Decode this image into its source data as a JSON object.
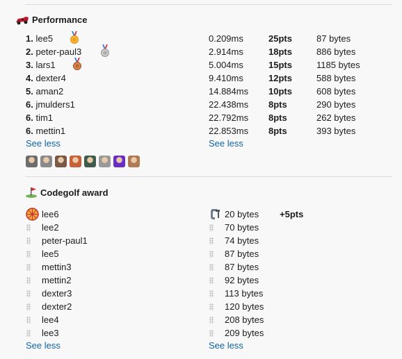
{
  "performance": {
    "title": "Performance",
    "rows": [
      {
        "rank": "1.",
        "name": "lee5",
        "time": "0.209ms",
        "pts": "25pts",
        "bytes": "87 bytes",
        "medal": "gold"
      },
      {
        "rank": "2.",
        "name": "peter-paul3",
        "time": "2.914ms",
        "pts": "18pts",
        "bytes": "886 bytes",
        "medal": "silver"
      },
      {
        "rank": "3.",
        "name": "lars1",
        "time": "5.004ms",
        "pts": "15pts",
        "bytes": "1185 bytes",
        "medal": "bronze"
      },
      {
        "rank": "4.",
        "name": "dexter4",
        "time": "9.410ms",
        "pts": "12pts",
        "bytes": "588 bytes",
        "medal": ""
      },
      {
        "rank": "5.",
        "name": "aman2",
        "time": "14.884ms",
        "pts": "10pts",
        "bytes": "608 bytes",
        "medal": ""
      },
      {
        "rank": "6.",
        "name": "jmulders1",
        "time": "22.438ms",
        "pts": "8pts",
        "bytes": "290 bytes",
        "medal": ""
      },
      {
        "rank": "6.",
        "name": "tim1",
        "time": "22.792ms",
        "pts": "8pts",
        "bytes": "262 bytes",
        "medal": ""
      },
      {
        "rank": "6.",
        "name": "mettin1",
        "time": "22.853ms",
        "pts": "8pts",
        "bytes": "393 bytes",
        "medal": ""
      }
    ],
    "see_less_left": "See less",
    "see_less_right": "See less",
    "avatar_colors": [
      "#6d6d6d",
      "#8a8a8a",
      "#7a5a44",
      "#c8603a",
      "#3f5b4b",
      "#9a9a9a",
      "#6a2fc2",
      "#b07a55"
    ]
  },
  "codegolf": {
    "title": "Codegolf award",
    "rows": [
      {
        "name": "lee6",
        "bytes": "20 bytes",
        "pts": "+5pts",
        "winner": true
      },
      {
        "name": "lee2",
        "bytes": "70 bytes",
        "pts": "",
        "winner": false
      },
      {
        "name": "peter-paul1",
        "bytes": "74 bytes",
        "pts": "",
        "winner": false
      },
      {
        "name": "lee5",
        "bytes": "87 bytes",
        "pts": "",
        "winner": false
      },
      {
        "name": "mettin3",
        "bytes": "87 bytes",
        "pts": "",
        "winner": false
      },
      {
        "name": "mettin2",
        "bytes": "92 bytes",
        "pts": "",
        "winner": false
      },
      {
        "name": "dexter3",
        "bytes": "113 bytes",
        "pts": "",
        "winner": false
      },
      {
        "name": "dexter2",
        "bytes": "120 bytes",
        "pts": "",
        "winner": false
      },
      {
        "name": "lee4",
        "bytes": "208 bytes",
        "pts": "",
        "winner": false
      },
      {
        "name": "lee3",
        "bytes": "209 bytes",
        "pts": "",
        "winner": false
      }
    ],
    "see_less_left": "See less",
    "see_less_right": "See less"
  }
}
